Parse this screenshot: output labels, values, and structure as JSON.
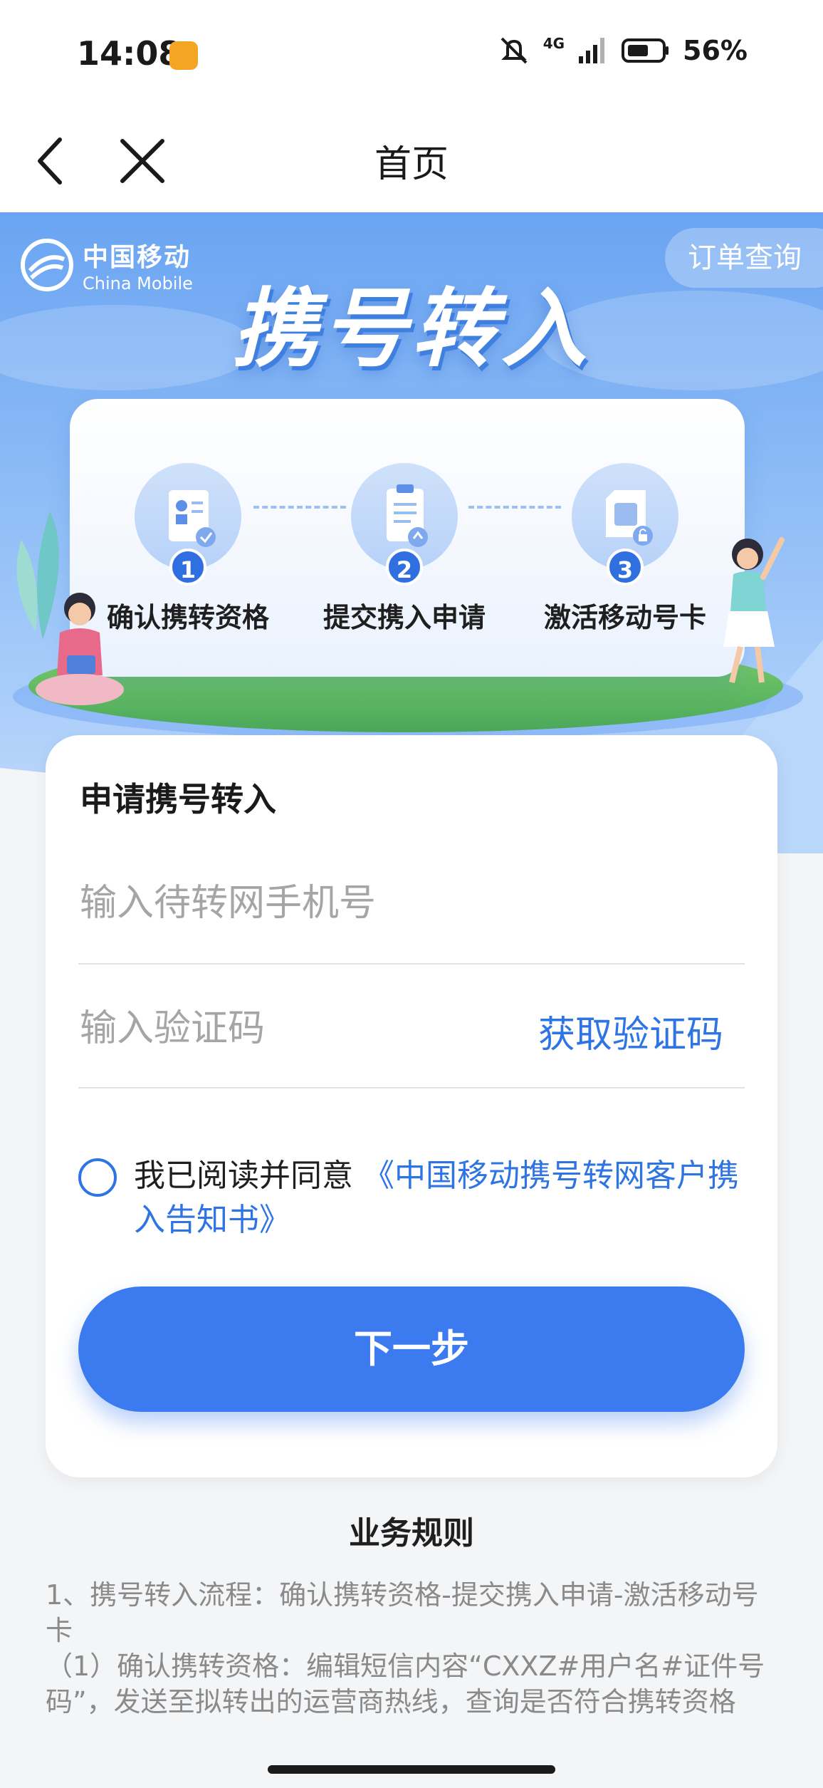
{
  "status_bar": {
    "time": "14:08",
    "network": "4G",
    "battery": "56%"
  },
  "nav": {
    "title": "首页"
  },
  "banner": {
    "logo_cn": "中国移动",
    "logo_en": "China Mobile",
    "order_query": "订单查询",
    "hero_title": "携号转入",
    "steps": [
      {
        "num": "1",
        "label": "确认携转资格"
      },
      {
        "num": "2",
        "label": "提交携入申请"
      },
      {
        "num": "3",
        "label": "激活移动号卡"
      }
    ]
  },
  "form": {
    "title": "申请携号转入",
    "phone_placeholder": "输入待转网手机号",
    "code_placeholder": "输入验证码",
    "get_code": "获取验证码",
    "agree_prefix": "我已阅读并同意 ",
    "agree_link": "《中国移动携号转网客户携入告知书》",
    "next_button": "下一步"
  },
  "rules": {
    "title": "业务规则",
    "lines": [
      "1、携号转入流程：确认携转资格-提交携入申请-激活移动号卡",
      "（1）确认携转资格：编辑短信内容“CXXZ#用户名#证件号码”，发送至拟转出的运营商热线，查询是否符合携转资格"
    ]
  },
  "colors": {
    "accent": "#3b7bef",
    "link": "#2f74e3",
    "banner_top": "#6aa4f2"
  }
}
